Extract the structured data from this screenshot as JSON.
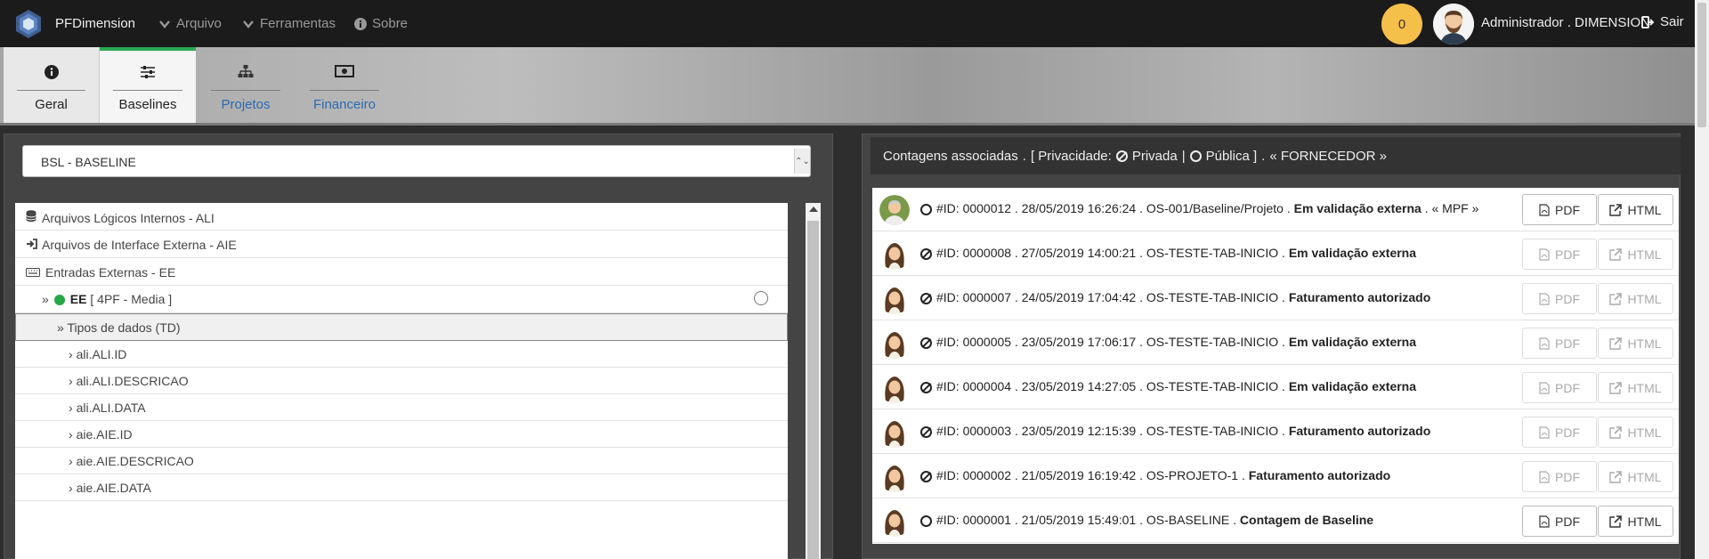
{
  "navbar": {
    "brand": "PFDimension",
    "menu": [
      {
        "label": "Arquivo",
        "icon": "chevron-down-icon"
      },
      {
        "label": "Ferramentas",
        "icon": "chevron-down-icon"
      },
      {
        "label": "Sobre",
        "icon": "info-icon"
      }
    ],
    "counter": "0",
    "user": "Administrador . DIMENSION",
    "logout": "Sair"
  },
  "tabs": [
    {
      "label": "Geral",
      "icon": "info-circle-icon"
    },
    {
      "label": "Baselines",
      "icon": "sliders-icon"
    },
    {
      "label": "Projetos",
      "icon": "sitemap-icon"
    },
    {
      "label": "Financeiro",
      "icon": "money-icon"
    }
  ],
  "left": {
    "select_value": "BSL - BASELINE",
    "tree": [
      {
        "label": "Arquivos Lógicos Internos - ALI",
        "icon": "database-icon"
      },
      {
        "label": "Arquivos de Interface Externa - AIE",
        "icon": "sign-in-icon"
      },
      {
        "label": "Entradas Externas - EE",
        "icon": "keyboard-icon"
      },
      {
        "label_bold": "EE",
        "label_rest": "[ 4PF - Media ]"
      },
      {
        "label": "Tipos de dados (TD)"
      },
      {
        "label": "ali.ALI.ID"
      },
      {
        "label": "ali.ALI.DESCRICAO"
      },
      {
        "label": "ali.ALI.DATA"
      },
      {
        "label": "aie.AIE.ID"
      },
      {
        "label": "aie.AIE.DESCRICAO"
      },
      {
        "label": "aie.AIE.DATA"
      }
    ]
  },
  "right": {
    "header": {
      "title": "Contagens associadas",
      "sep1": ".",
      "privacy_open": "[ Privacidade:",
      "private": "Privada",
      "pipe": "|",
      "public": "Pública ]",
      "sep2": ".",
      "provider": "« FORNECEDOR »"
    },
    "buttons": {
      "pdf": "PDF",
      "html": "HTML"
    },
    "items": [
      {
        "text": "#ID: 0000012 . 28/05/2019 16:26:24 . OS-001/Baseline/Projeto . ",
        "status": "Em validação externa",
        "extra": " . « MPF »",
        "privacy": "public",
        "avatar": "man",
        "enabled": true
      },
      {
        "text": "#ID: 0000008 . 27/05/2019 14:00:21 . OS-TESTE-TAB-INICIO . ",
        "status": "Em validação externa",
        "extra": "",
        "privacy": "private",
        "avatar": "woman",
        "enabled": false
      },
      {
        "text": "#ID: 0000007 . 24/05/2019 17:04:42 . OS-TESTE-TAB-INICIO . ",
        "status": "Faturamento autorizado",
        "extra": "",
        "privacy": "private",
        "avatar": "woman",
        "enabled": false
      },
      {
        "text": "#ID: 0000005 . 23/05/2019 17:06:17 . OS-TESTE-TAB-INICIO . ",
        "status": "Em validação externa",
        "extra": "",
        "privacy": "private",
        "avatar": "woman",
        "enabled": false
      },
      {
        "text": "#ID: 0000004 . 23/05/2019 14:27:05 . OS-TESTE-TAB-INICIO . ",
        "status": "Em validação externa",
        "extra": "",
        "privacy": "private",
        "avatar": "woman",
        "enabled": false
      },
      {
        "text": "#ID: 0000003 . 23/05/2019 12:15:39 . OS-TESTE-TAB-INICIO . ",
        "status": "Faturamento autorizado",
        "extra": "",
        "privacy": "private",
        "avatar": "woman",
        "enabled": false
      },
      {
        "text": "#ID: 0000002 . 21/05/2019 16:19:42 . OS-PROJETO-1 . ",
        "status": "Faturamento autorizado",
        "extra": "",
        "privacy": "private",
        "avatar": "woman",
        "enabled": false
      },
      {
        "text": "#ID: 0000001 . 21/05/2019 15:49:01 . OS-BASELINE . ",
        "status": "Contagem de Baseline",
        "extra": "",
        "privacy": "public",
        "avatar": "woman",
        "enabled": true
      }
    ]
  }
}
